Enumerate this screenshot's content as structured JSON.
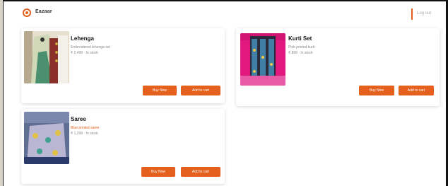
{
  "header": {
    "logo_text": "Eazaar",
    "logout_label": "Log out"
  },
  "products": [
    {
      "title": "Lehenga",
      "subtitle": "Embroidered lehenga set",
      "meta": "₹ 2,499 · In stock",
      "buy_label": "Buy Now",
      "cart_label": "Add to cart"
    },
    {
      "title": "Kurti Set",
      "subtitle": "Pink printed kurti",
      "meta": "₹ 899 · In stock",
      "buy_label": "Buy Now",
      "cart_label": "Add to cart"
    },
    {
      "title": "Saree",
      "subtitle": "Blue printed saree",
      "meta": "₹ 1,299 · In stock",
      "buy_label": "Buy Now",
      "cart_label": "Add to cart"
    }
  ],
  "colors": {
    "accent": "#e4601c"
  }
}
